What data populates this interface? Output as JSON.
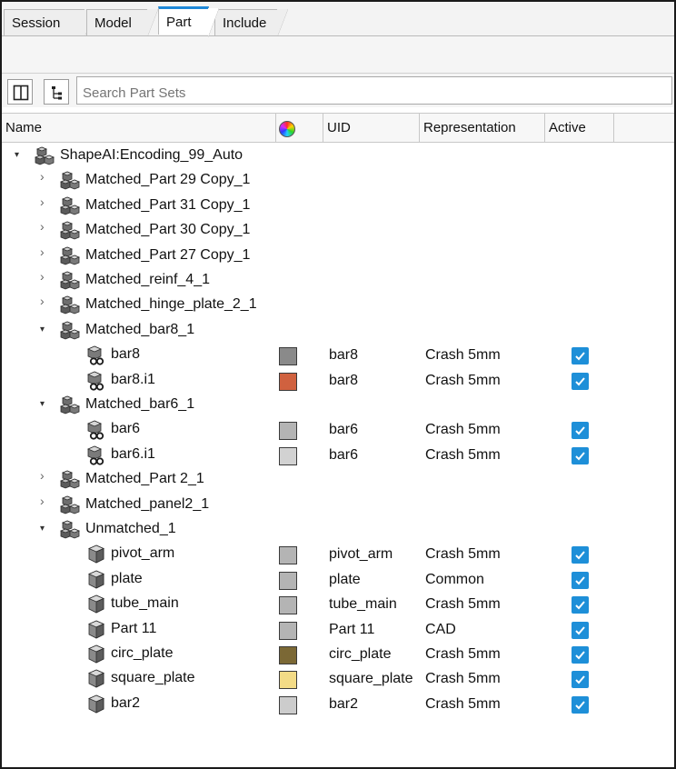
{
  "tabs": [
    {
      "label": "Session",
      "active": false
    },
    {
      "label": "Model",
      "active": false
    },
    {
      "label": "Part",
      "active": true
    },
    {
      "label": "Include",
      "active": false
    }
  ],
  "toolbar": {
    "search_placeholder": "Search Part Sets",
    "buttons": [
      "panel-layout-icon",
      "tree-view-icon"
    ]
  },
  "columns": {
    "name": "Name",
    "color": "color-wheel-icon",
    "uid": "UID",
    "representation": "Representation",
    "active": "Active"
  },
  "tree": [
    {
      "kind": "assembly",
      "level": 0,
      "expanded": true,
      "name": "ShapeAI:Encoding_99_Auto"
    },
    {
      "kind": "assembly",
      "level": 1,
      "expanded": false,
      "name": "Matched_Part 29 Copy_1"
    },
    {
      "kind": "assembly",
      "level": 1,
      "expanded": false,
      "name": "Matched_Part 31 Copy_1"
    },
    {
      "kind": "assembly",
      "level": 1,
      "expanded": false,
      "name": "Matched_Part 30 Copy_1"
    },
    {
      "kind": "assembly",
      "level": 1,
      "expanded": false,
      "name": "Matched_Part 27 Copy_1"
    },
    {
      "kind": "assembly",
      "level": 1,
      "expanded": false,
      "name": "Matched_reinf_4_1"
    },
    {
      "kind": "assembly",
      "level": 1,
      "expanded": false,
      "name": "Matched_hinge_plate_2_1"
    },
    {
      "kind": "assembly",
      "level": 1,
      "expanded": true,
      "name": "Matched_bar8_1"
    },
    {
      "kind": "instance",
      "level": 2,
      "name": "bar8",
      "color": "#8a8a8a",
      "uid": "bar8",
      "rep": "Crash 5mm",
      "active": true
    },
    {
      "kind": "instance",
      "level": 2,
      "name": "bar8.i1",
      "color": "#d0613f",
      "uid": "bar8",
      "rep": "Crash 5mm",
      "active": true
    },
    {
      "kind": "assembly",
      "level": 1,
      "expanded": true,
      "name": "Matched_bar6_1"
    },
    {
      "kind": "instance",
      "level": 2,
      "name": "bar6",
      "color": "#b4b4b4",
      "uid": "bar6",
      "rep": "Crash 5mm",
      "active": true
    },
    {
      "kind": "instance",
      "level": 2,
      "name": "bar6.i1",
      "color": "#d2d2d2",
      "uid": "bar6",
      "rep": "Crash 5mm",
      "active": true
    },
    {
      "kind": "assembly",
      "level": 1,
      "expanded": false,
      "name": "Matched_Part 2_1"
    },
    {
      "kind": "assembly",
      "level": 1,
      "expanded": false,
      "name": "Matched_panel2_1"
    },
    {
      "kind": "assembly",
      "level": 1,
      "expanded": true,
      "name": "Unmatched_1"
    },
    {
      "kind": "part",
      "level": 2,
      "name": "pivot_arm",
      "color": "#b4b4b4",
      "uid": "pivot_arm",
      "rep": "Crash 5mm",
      "active": true
    },
    {
      "kind": "part",
      "level": 2,
      "name": "plate",
      "color": "#b4b4b4",
      "uid": "plate",
      "rep": "Common",
      "active": true
    },
    {
      "kind": "part",
      "level": 2,
      "name": "tube_main",
      "color": "#b4b4b4",
      "uid": "tube_main",
      "rep": "Crash 5mm",
      "active": true
    },
    {
      "kind": "part",
      "level": 2,
      "name": "Part 11",
      "color": "#b4b4b4",
      "uid": "Part 11",
      "rep": "CAD",
      "active": true
    },
    {
      "kind": "part",
      "level": 2,
      "name": "circ_plate",
      "color": "#7b6835",
      "uid": "circ_plate",
      "rep": "Crash 5mm",
      "active": true
    },
    {
      "kind": "part",
      "level": 2,
      "name": "square_plate",
      "color": "#f3db86",
      "uid": "square_plate",
      "rep": "Crash 5mm",
      "active": true
    },
    {
      "kind": "part",
      "level": 2,
      "name": "bar2",
      "color": "#cccccc",
      "uid": "bar2",
      "rep": "Crash 5mm",
      "active": true
    }
  ]
}
